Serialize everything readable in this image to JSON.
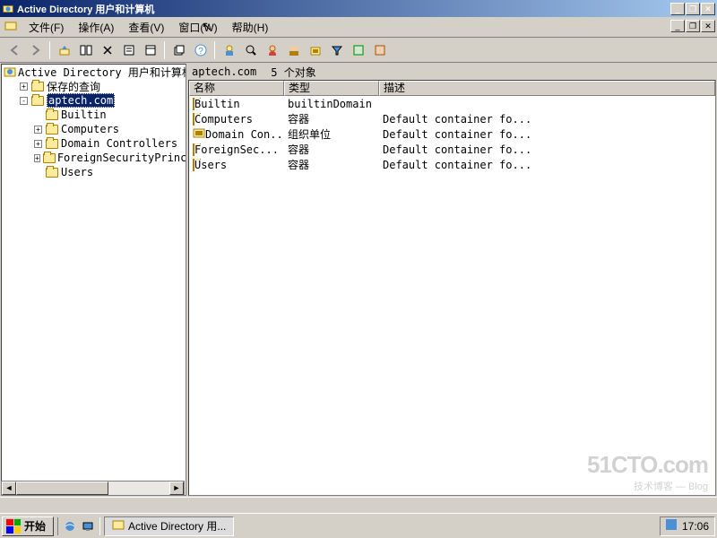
{
  "window": {
    "title": "Active Directory 用户和计算机"
  },
  "menu": {
    "file": "文件(F)",
    "action": "操作(A)",
    "view": "查看(V)",
    "window": "窗口(W)",
    "help": "帮助(H)"
  },
  "toolbar": {
    "back": "back-arrow",
    "forward": "forward-arrow",
    "up": "up-level",
    "cut": "cut",
    "copy": "copy",
    "paste": "paste",
    "delete": "delete",
    "properties": "properties",
    "refresh": "refresh",
    "help": "help",
    "filter": "filter",
    "find": "find",
    "newuser": "new-user",
    "col1": "col1",
    "col2": "col2"
  },
  "tree": {
    "root": "Active Directory 用户和计算机",
    "items": [
      {
        "label": "保存的查询",
        "indent": 1,
        "exp": "+"
      },
      {
        "label": "aptech.com",
        "indent": 1,
        "exp": "-",
        "selected": true
      },
      {
        "label": "Builtin",
        "indent": 2,
        "exp": ""
      },
      {
        "label": "Computers",
        "indent": 2,
        "exp": "+"
      },
      {
        "label": "Domain Controllers",
        "indent": 2,
        "exp": "+"
      },
      {
        "label": "ForeignSecurityPrincipal",
        "indent": 2,
        "exp": "+"
      },
      {
        "label": "Users",
        "indent": 2,
        "exp": ""
      }
    ]
  },
  "pathbar": {
    "path": "aptech.com",
    "count": "5 个对象"
  },
  "list": {
    "columns": {
      "name": "名称",
      "type": "类型",
      "desc": "描述"
    },
    "colw": {
      "name": 106,
      "type": 106,
      "desc": 260
    },
    "rows": [
      {
        "name": "Builtin",
        "type": "builtinDomain",
        "desc": "",
        "icon": "folder"
      },
      {
        "name": "Computers",
        "type": "容器",
        "desc": "Default container fo...",
        "icon": "folder"
      },
      {
        "name": "Domain Con...",
        "type": "组织单位",
        "desc": "Default container fo...",
        "icon": "ou"
      },
      {
        "name": "ForeignSec...",
        "type": "容器",
        "desc": "Default container fo...",
        "icon": "folder"
      },
      {
        "name": "Users",
        "type": "容器",
        "desc": "Default container fo...",
        "icon": "folder"
      }
    ]
  },
  "taskbar": {
    "start": "开始",
    "task": "Active Directory 用...",
    "clock": "17:06"
  },
  "watermark": {
    "a": "51CTO.com",
    "b": "技术博客 — Blog"
  }
}
